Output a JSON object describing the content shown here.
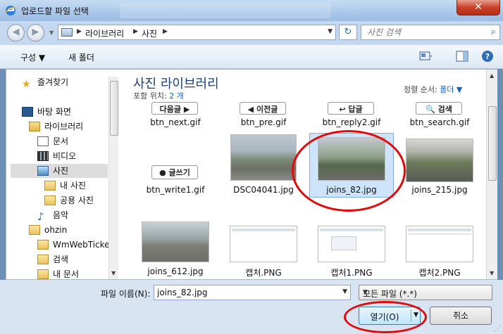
{
  "window": {
    "title": "업로드할 파일 선택",
    "close_glyph": "✕"
  },
  "nav": {
    "back_glyph": "◀",
    "forward_glyph": "▶",
    "history_glyph": "▼"
  },
  "address": {
    "crumbs": [
      "라이브러리",
      "사진"
    ],
    "sep_glyph": "▶",
    "drop_glyph": "▼",
    "refresh_glyph": "↻"
  },
  "search": {
    "placeholder": "사진 검색",
    "icon": "search-icon",
    "glyph": "⌕"
  },
  "toolbar": {
    "organize_label": "구성 ▼",
    "new_folder_label": "새 폴더",
    "help_glyph": "?"
  },
  "sidebar": {
    "items": [
      {
        "label": "즐겨찾기",
        "icon": "star-icon"
      },
      {
        "label": "바탕 화면",
        "icon": "desktop-icon"
      },
      {
        "label": "라이브러리",
        "icon": "library-icon"
      },
      {
        "label": "문서",
        "icon": "document-icon"
      },
      {
        "label": "비디오",
        "icon": "video-icon"
      },
      {
        "label": "사진",
        "icon": "pictures-icon"
      },
      {
        "label": "내 사진",
        "icon": "folder-icon"
      },
      {
        "label": "공용 사진",
        "icon": "folder-icon"
      },
      {
        "label": "음악",
        "icon": "music-icon"
      },
      {
        "label": "ohzin",
        "icon": "user-folder-icon"
      },
      {
        "label": "WmWebTicker",
        "icon": "folder-icon"
      },
      {
        "label": "검색",
        "icon": "search-folder-icon"
      },
      {
        "label": "내 문서",
        "icon": "folder-icon"
      }
    ]
  },
  "library": {
    "title": "사진 라이브러리",
    "includes_label": "포함 위치:",
    "includes_value": "2 개",
    "sort_label": "정렬 순서:",
    "sort_value": "폴더 ▼"
  },
  "files": [
    {
      "name": "btn_next.gif",
      "thumb_text": "다음글 ▶"
    },
    {
      "name": "btn_pre.gif",
      "thumb_text": "◀ 이전글"
    },
    {
      "name": "btn_reply2.gif",
      "thumb_text": "↩ 답글"
    },
    {
      "name": "btn_search.gif",
      "thumb_text": "🔍 검색"
    },
    {
      "name": "btn_write1.gif",
      "thumb_text": "● 글쓰기"
    },
    {
      "name": "DSC04041.jpg"
    },
    {
      "name": "joins_82.jpg",
      "selected": true
    },
    {
      "name": "joins_215.jpg"
    },
    {
      "name": "joins_612.jpg"
    },
    {
      "name": "캡처.PNG"
    },
    {
      "name": "캡처1.PNG"
    },
    {
      "name": "캡처2.PNG"
    }
  ],
  "footer": {
    "filename_label": "파일 이름(N):",
    "filename_value": "joins_82.jpg",
    "filetype_value": "모든 파일 (*.*)",
    "open_label": "열기(O)",
    "cancel_label": "취소"
  },
  "colors": {
    "annotation": "#e00a0a",
    "link": "#1a5fb4",
    "title_text": "#1e3f7a"
  }
}
